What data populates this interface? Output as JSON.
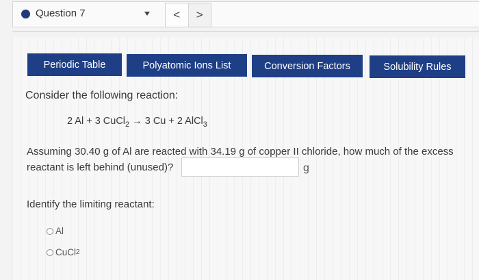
{
  "header": {
    "question_label": "Question 7",
    "prev_symbol": "<",
    "next_symbol": ">"
  },
  "tabs": [
    {
      "label": "Periodic Table"
    },
    {
      "label": "Polyatomic Ions List"
    },
    {
      "label": "Conversion Factors"
    },
    {
      "label": "Solubility Rules"
    }
  ],
  "content": {
    "intro": "Consider the following reaction:",
    "equation": {
      "part1": "2 Al + 3 CuCl",
      "sub1": "2",
      "part2": " → 3 Cu + 2 AlCl",
      "sub2": "3"
    },
    "question_text": "Assuming 30.40 g of Al are reacted  with 34.19 g of copper II chloride, how much of the excess reactant is left behind (unused)?",
    "answer_value": "",
    "unit": "g",
    "limiting_label": "Identify the limiting reactant:",
    "options": [
      {
        "label": "Al",
        "sub": ""
      },
      {
        "label": "CuCl",
        "sub": "2"
      }
    ]
  },
  "colors": {
    "tab_bg": "#1e3f86",
    "dot": "#1f3c78"
  }
}
